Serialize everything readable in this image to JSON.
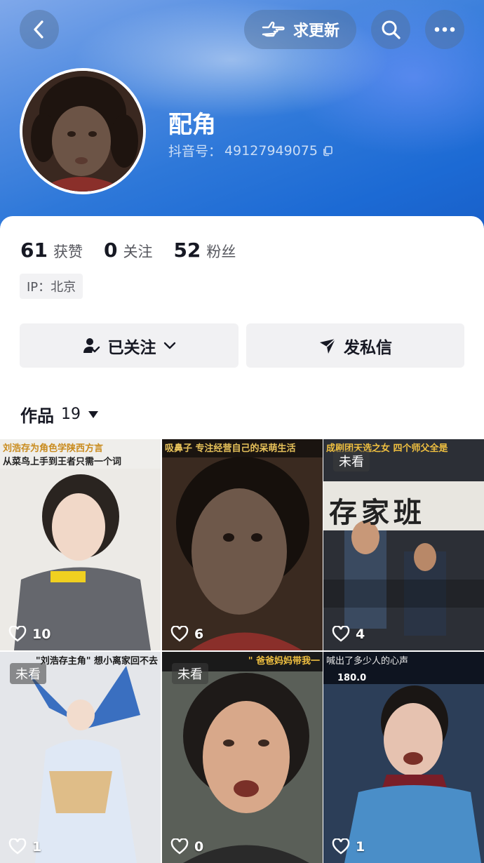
{
  "header": {
    "back_icon": "chevron-left-icon",
    "update_label": "求更新",
    "update_icon": "pointing-hand-icon",
    "search_icon": "search-icon",
    "more_icon": "more-dots-icon"
  },
  "profile": {
    "name": "配角",
    "douyin_id_label": "抖音号：",
    "douyin_id": "49127949075",
    "copy_icon": "copy-icon"
  },
  "stats": [
    {
      "num": "61",
      "label": "获赞"
    },
    {
      "num": "0",
      "label": "关注"
    },
    {
      "num": "52",
      "label": "粉丝"
    }
  ],
  "ip": "IP：北京",
  "actions": {
    "follow_label": "已关注",
    "message_label": "发私信"
  },
  "works": {
    "title": "作品",
    "count": "19"
  },
  "videos": [
    {
      "caption_line1": "刘浩存为角色学陕西方言",
      "caption_line2": "从菜鸟上手到王者只需一个词",
      "likes": "10",
      "unseen": ""
    },
    {
      "caption_line1": "吸鼻子  专注经营自己的呆萌生活",
      "caption_line2": "",
      "likes": "6",
      "unseen": ""
    },
    {
      "caption_line1": "成剧团天选之女  四个师父全是",
      "caption_line2": "存家班",
      "likes": "4",
      "unseen": "未看"
    },
    {
      "caption_line1": "\"刘浩存主角\"  想小离家回不去",
      "caption_line2": "",
      "likes": "1",
      "unseen": "未看"
    },
    {
      "caption_line1": "\" 爸爸妈妈带我一",
      "caption_line2": "",
      "likes": "0",
      "unseen": "未看"
    },
    {
      "caption_line1": "喊出了多少人的心声",
      "caption_line2": "180.0",
      "likes": "1",
      "unseen": ""
    }
  ],
  "colors": {
    "banner_top": "#7fa8ea",
    "banner_bottom": "#195fc8",
    "button_bg": "#f1f1f3",
    "text_primary": "#161823",
    "text_secondary": "#57585f"
  }
}
